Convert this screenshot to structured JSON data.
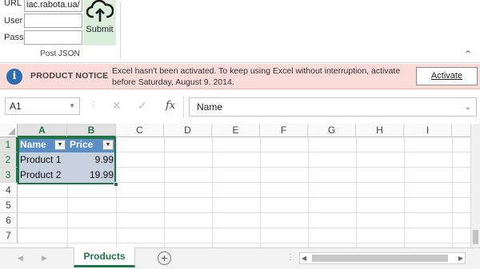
{
  "ribbon": {
    "url_label": "URL",
    "url_value": "iac.rabota.ua/",
    "user_label": "User",
    "user_value": "",
    "pass_label": "Pass",
    "pass_value": "",
    "submit_label": "Submit",
    "submit_icon": "cloud-upload-icon",
    "group_label": "Post JSON"
  },
  "notice": {
    "title": "PRODUCT NOTICE",
    "message": "Excel hasn't been activated. To keep using Excel without interruption, activate before Saturday, August 9, 2014.",
    "button": "Activate",
    "icon": "info-icon",
    "color": "#f9dbd8"
  },
  "formula_bar": {
    "name_box": "A1",
    "fx": "fx",
    "content": "Name"
  },
  "grid": {
    "columns": [
      "A",
      "B",
      "C",
      "D",
      "E",
      "F",
      "G",
      "H",
      "I"
    ],
    "rows": [
      "1",
      "2",
      "3",
      "4",
      "5",
      "6",
      "7"
    ],
    "table": {
      "headers": [
        "Name",
        "Price"
      ],
      "rows": [
        [
          "Product 1",
          "9.99"
        ],
        [
          "Product 2",
          "19.99"
        ]
      ]
    },
    "accent": "#217346"
  },
  "tabs": {
    "active": "Products",
    "add_icon": "plus-circle-icon"
  }
}
